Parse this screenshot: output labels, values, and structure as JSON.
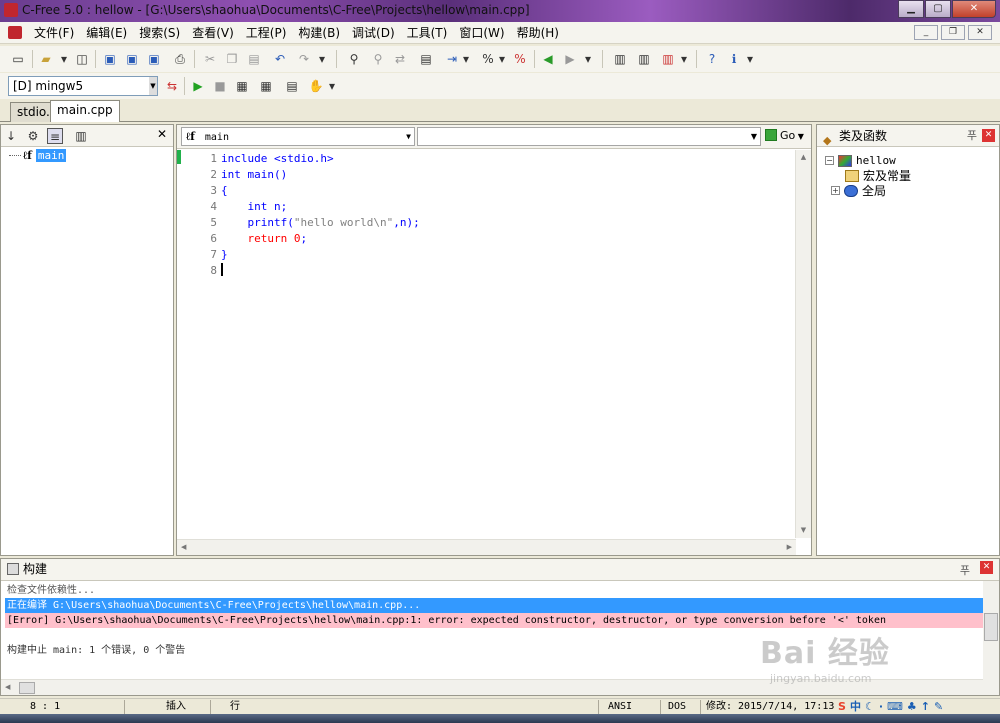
{
  "window": {
    "title": "C-Free 5.0 : hellow - [G:\\Users\\shaohua\\Documents\\C-Free\\Projects\\hellow\\main.cpp]"
  },
  "menu": [
    "文件(F)",
    "编辑(E)",
    "搜索(S)",
    "查看(V)",
    "工程(P)",
    "构建(B)",
    "调试(D)",
    "工具(T)",
    "窗口(W)",
    "帮助(H)"
  ],
  "toolbar": {
    "compiler": "[D] mingw5"
  },
  "tabs": [
    "stdio.h",
    "main.cpp"
  ],
  "left_panel": {
    "tree_item": "main"
  },
  "editor": {
    "function_selector": "main",
    "go_label": "Go",
    "lines": [
      {
        "n": "1",
        "kw": "",
        "rest": "include <stdio.h>"
      },
      {
        "n": "2",
        "kw": "int",
        "rest": " main()"
      },
      {
        "n": "3",
        "kw": "",
        "rest": "{"
      },
      {
        "n": "4",
        "kw": "    int",
        "rest": " n;"
      },
      {
        "n": "5",
        "kw": "    printf",
        "rest": "("
      },
      {
        "n": "6",
        "kw": "    return",
        "rest": " "
      },
      {
        "n": "7",
        "kw": "",
        "rest": "}"
      },
      {
        "n": "8",
        "kw": "",
        "rest": ""
      }
    ],
    "line5_str": "\"hello world\\n\"",
    "line5_tail": ",n);",
    "line6_num": "0",
    "line6_tail": ";"
  },
  "right_panel": {
    "title": "类及函数",
    "root": "hellow",
    "children": [
      "宏及常量",
      "全局"
    ]
  },
  "build": {
    "title": "构建",
    "lines": [
      "检查文件依赖性...",
      "正在编译 G:\\Users\\shaohua\\Documents\\C-Free\\Projects\\hellow\\main.cpp...",
      "[Error] G:\\Users\\shaohua\\Documents\\C-Free\\Projects\\hellow\\main.cpp:1: error: expected constructor, destructor, or type conversion before '<' token",
      "构建中止 main: 1 个错误, 0 个警告"
    ]
  },
  "status": {
    "position": "8 :  1",
    "mode": "插入",
    "line_label": "行",
    "encoding": "ANSI",
    "line_end": "DOS",
    "modified": "修改: 2015/7/14, 17:13"
  },
  "watermark": {
    "brand": "Bai 经验",
    "url": "jingyan.baidu.com"
  },
  "colors": {
    "selection": "#3399ff",
    "error_bg": "#ffc0cb",
    "keyword": "#0000ff",
    "number": "#ff0000"
  }
}
